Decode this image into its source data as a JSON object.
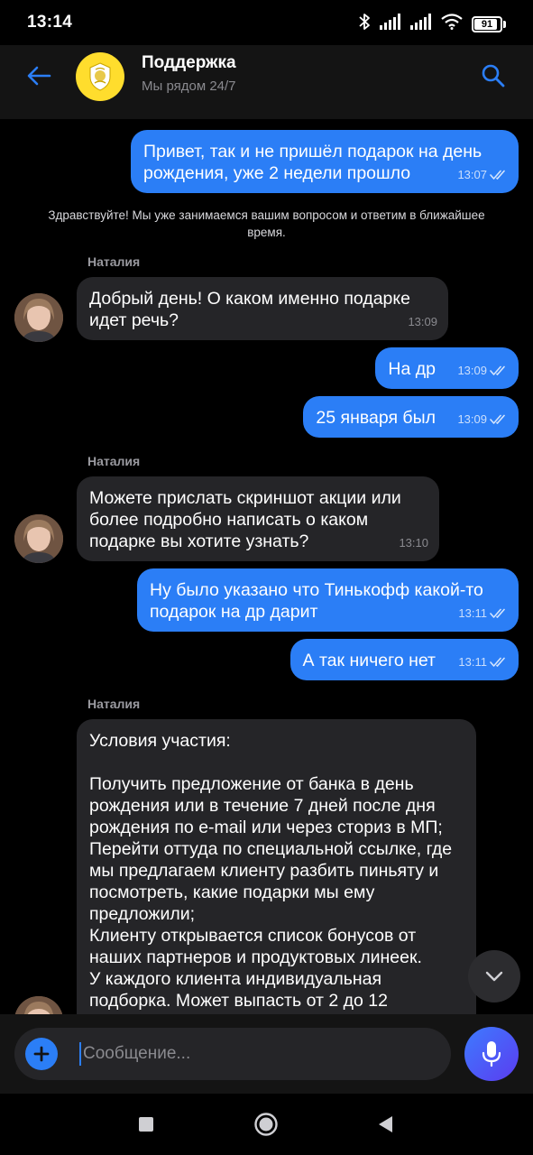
{
  "status_bar": {
    "time": "13:14",
    "battery_level": "91",
    "icons": [
      "bluetooth-icon",
      "signal-icon",
      "signal-icon",
      "wifi-icon",
      "battery-icon"
    ]
  },
  "header": {
    "title": "Поддержка",
    "subtitle": "Мы рядом 24/7",
    "back_icon": "arrow-left-icon",
    "search_icon": "search-icon",
    "accent_color": "#2b7ef6",
    "logo_color": "#ffdd2d"
  },
  "messages": [
    {
      "direction": "out",
      "text": "Привет, так и не пришёл подарок на день рождения, уже 2 недели прошло",
      "time": "13:07",
      "status": "read"
    },
    {
      "type": "system",
      "text": "Здравствуйте! Мы уже занимаемся вашим вопросом и ответим в ближайшее время."
    },
    {
      "direction": "in",
      "sender": "Наталия",
      "text": "Добрый день! О каком именно подарке идет речь?",
      "time": "13:09"
    },
    {
      "direction": "out",
      "text": "На др",
      "time": "13:09",
      "status": "read"
    },
    {
      "direction": "out",
      "text": "25 января был",
      "time": "13:09",
      "status": "read"
    },
    {
      "direction": "in",
      "sender": "Наталия",
      "text": "Можете прислать скриншот акции или более подробно написать о каком подарке вы хотите узнать?",
      "time": "13:10"
    },
    {
      "direction": "out",
      "text": "Ну было указано что Тинькофф какой-то подарок на др дарит",
      "time": "13:11",
      "status": "read"
    },
    {
      "direction": "out",
      "text": "А так ничего нет",
      "time": "13:11",
      "status": "read"
    },
    {
      "direction": "in",
      "sender": "Наталия",
      "text": "Условия участия:\n\nПолучить предложение от банка в день рождения или в течение 7 дней после дня рождения по e-mail или через сториз в МП;\nПерейти оттуда по специальной ссылке, где мы предлагаем клиенту разбить пиньяту и посмотреть, какие подарки мы ему предложили;\nКлиенту открывается список бонусов от наших партнеров и продуктовых линеек.\nУ каждого клиента индивидуальная подборка. Может выпасть от 2 до 12"
    }
  ],
  "composer": {
    "placeholder": "Сообщение...",
    "value": "",
    "plus_icon": "plus-icon",
    "mic_icon": "microphone-icon"
  },
  "scroll_down_icon": "chevron-down-icon",
  "nav_bar": {
    "icons": [
      "recent-apps-icon",
      "home-icon",
      "back-triangle-icon"
    ]
  }
}
